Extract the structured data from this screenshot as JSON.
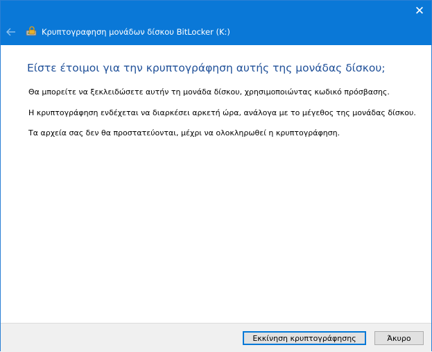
{
  "window": {
    "title": "Κρυπτογραφηση μονάδων δίσκου BitLocker (K:)",
    "close_glyph": "✕",
    "back_icon": "back-arrow-icon",
    "app_icon": "bitlocker-drive-icon",
    "accent_color": "#0a78d7"
  },
  "content": {
    "heading": "Είστε έτοιμοι για την κρυπτογράφηση αυτής της μονάδας δίσκου;",
    "paragraphs": [
      "Θα μπορείτε να ξεκλειδώσετε αυτήν τη μονάδα δίσκου, χρησιμοποιώντας κωδικό πρόσβασης.",
      "Η κρυπτογράφηση ενδέχεται να διαρκέσει αρκετή ώρα, ανάλογα με το μέγεθος της μονάδας δίσκου.",
      "Τα αρχεία σας δεν θα προστατεύονται, μέχρι να ολοκληρωθεί η κρυπτογράφηση."
    ]
  },
  "footer": {
    "start_label": "Εκκίνηση κρυπτογράφησης",
    "cancel_label": "Άκυρο"
  }
}
